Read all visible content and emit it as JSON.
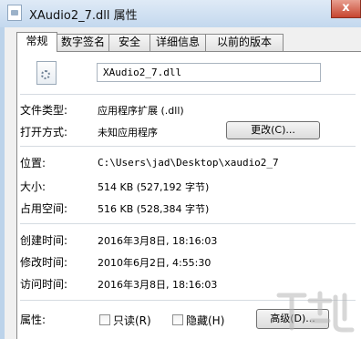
{
  "window": {
    "title": "XAudio2_7.dll 属性",
    "close_label": "x"
  },
  "tabs": [
    {
      "label": "常规",
      "active": true
    },
    {
      "label": "数字签名",
      "active": false
    },
    {
      "label": "安全",
      "active": false
    },
    {
      "label": "详细信息",
      "active": false
    },
    {
      "label": "以前的版本",
      "active": false
    }
  ],
  "general": {
    "file_name": "XAudio2_7.dll",
    "file_type_label": "文件类型:",
    "file_type_value": "应用程序扩展 (.dll)",
    "opens_with_label": "打开方式:",
    "opens_with_value": "未知应用程序",
    "change_button": "更改(C)...",
    "location_label": "位置:",
    "location_value": "C:\\Users\\jad\\Desktop\\xaudio2_7",
    "size_label": "大小:",
    "size_value": "514 KB (527,192 字节)",
    "size_on_disk_label": "占用空间:",
    "size_on_disk_value": "516 KB (528,384 字节)",
    "created_label": "创建时间:",
    "created_value": "2016年3月8日, 18:16:03",
    "modified_label": "修改时间:",
    "modified_value": "2010年6月2日, 4:55:30",
    "accessed_label": "访问时间:",
    "accessed_value": "2016年3月8日, 18:16:03",
    "attributes_label": "属性:",
    "readonly_label": "只读(R)",
    "hidden_label": "隐藏(H)",
    "advanced_button": "高级(D)...",
    "readonly_checked": false,
    "hidden_checked": false
  },
  "icons": {
    "title": "dll-file-icon",
    "file": "dll-file-large-icon",
    "close": "close-icon",
    "watermark": "watermark-logo"
  }
}
